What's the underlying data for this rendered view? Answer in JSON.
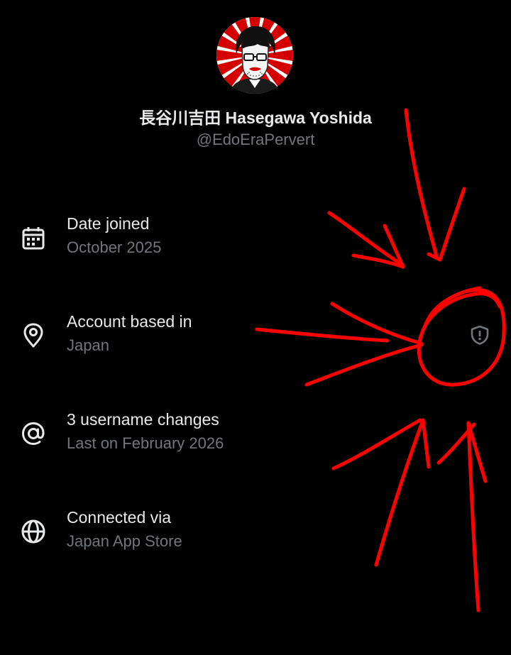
{
  "profile": {
    "display_name": "長谷川吉田 Hasegawa Yoshida",
    "handle": "@EdoEraPervert",
    "avatar_icon": "avatar-portrait-rising-sun"
  },
  "about": {
    "rows": [
      {
        "icon": "calendar-icon",
        "label": "Date joined",
        "value": "October 2025"
      },
      {
        "icon": "location-pin-icon",
        "label": "Account based in",
        "value": "Japan"
      },
      {
        "icon": "at-sign-icon",
        "label": "3 username changes",
        "value": "Last on February 2026"
      },
      {
        "icon": "globe-icon",
        "label": "Connected via",
        "value": "Japan App Store"
      }
    ],
    "verification_icon": "shield-exclamation-icon"
  },
  "annotation": {
    "color": "#ff0000",
    "description_icon": "hand-drawn-arrows-circle"
  },
  "colors": {
    "background": "#000000",
    "primary_text": "#e7e9ea",
    "secondary_text": "#71767b",
    "annotation": "#ff0000"
  }
}
